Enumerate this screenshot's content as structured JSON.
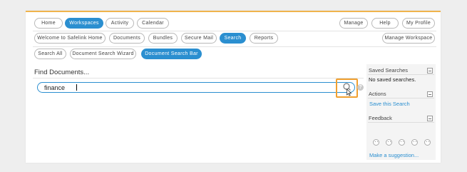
{
  "top_nav": {
    "left": [
      "Home",
      "Workspaces",
      "Activity",
      "Calendar"
    ],
    "right": [
      "Manage",
      "Help",
      "My Profile"
    ],
    "active": "Workspaces"
  },
  "sub_nav": {
    "items": [
      "Welcome to Safelink Home",
      "Documents",
      "Bundles",
      "Secure Mail",
      "Search",
      "Reports"
    ],
    "active": "Search",
    "manage_workspace": "Manage Workspace"
  },
  "search_tabs": {
    "items": [
      "Search All",
      "Document Search Wizard",
      "Document Search Bar"
    ],
    "active": "Document Search Bar"
  },
  "main": {
    "title": "Find Documents...",
    "search_value": "finance",
    "search_icon": "magnifier-icon",
    "help_icon": "question-icon",
    "help_glyph": "?"
  },
  "sidebar": {
    "saved_searches": {
      "title": "Saved Searches",
      "empty_text": "No saved searches."
    },
    "actions": {
      "title": "Actions",
      "link": "Save this Search"
    },
    "feedback": {
      "title": "Feedback",
      "faces": [
        "very-unhappy",
        "unhappy",
        "neutral",
        "happy",
        "very-happy"
      ],
      "link": "Make a suggestion..."
    }
  },
  "colors": {
    "accent": "#2b8fd0",
    "highlight": "#f0a030",
    "top_border": "#f0b44c"
  }
}
